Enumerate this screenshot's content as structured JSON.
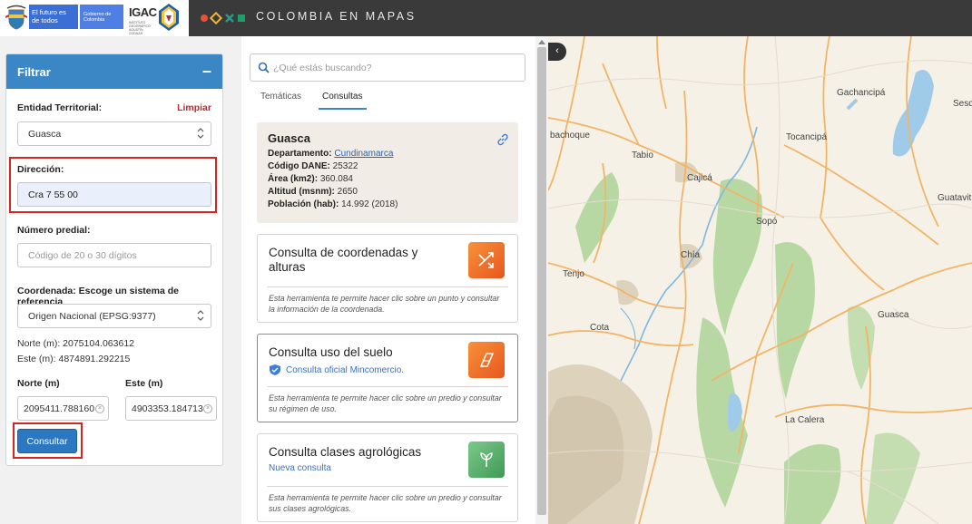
{
  "header": {
    "gov_text_1": "El futuro es de todos",
    "gov_text_2": "Gobierno de Colombia",
    "igac_text": "IGAC",
    "igac_subtitle": "INSTITUTO GEOGRÁFICO AGUSTÍN CODAZZI",
    "title": "COLOMBIA EN MAPAS",
    "brand_colors": [
      "#e8503a",
      "#f2b43a",
      "#2a9b8c",
      "#1e9d6b"
    ]
  },
  "filter": {
    "title": "Filtrar",
    "collapse_label": "–",
    "entity_label": "Entidad Territorial:",
    "clear_label": "Limpiar",
    "entity_value": "Guasca",
    "address_label": "Dirección:",
    "address_value": "Cra 7 55 00",
    "predial_label": "Número predial:",
    "predial_placeholder": "Código de 20 o 30 dígitos",
    "coord_label": "Coordenada: Escoge un sistema de referencia",
    "coord_system": "Origen Nacional (EPSG:9377)",
    "norte_text": "Norte (m): 2075104.063612",
    "este_text": "Este (m): 4874891.292215",
    "norte_input_label": "Norte (m)",
    "este_input_label": "Este (m)",
    "norte_input_value": "2095411.788160",
    "este_input_value": "4903353.184713",
    "submit_label": "Consultar"
  },
  "search": {
    "placeholder": "¿Qué estás buscando?"
  },
  "tabs": [
    {
      "label": "Temáticas",
      "active": false
    },
    {
      "label": "Consultas",
      "active": true
    }
  ],
  "municipality": {
    "name": "Guasca",
    "department_label": "Departamento:",
    "department_value": "Cundinamarca",
    "dane_label": "Código DANE:",
    "dane_value": "25322",
    "area_label": "Área (km2):",
    "area_value": "360.084",
    "altitude_label": "Altitud (msnm):",
    "altitude_value": "2650",
    "population_label": "Población (hab):",
    "population_value": "14.992 (2018)"
  },
  "tools": [
    {
      "title": "Consulta de coordenadas y alturas",
      "subtitle": "",
      "description": "Esta herramienta te permite hacer clic sobre un punto y consultar la información de la coordenada.",
      "icon": "shuffle-icon"
    },
    {
      "title": "Consulta uso del suelo",
      "subtitle": "Consulta oficial Mincomercio.",
      "description": "Esta herramienta te permite hacer clic sobre un predio y consultar su régimen de uso.",
      "icon": "parcel-icon"
    },
    {
      "title": "Consulta clases agrológicas",
      "subtitle": "Nueva consulta",
      "description": "Esta herramienta te permite hacer clic sobre un predio y consultar sus clases agrológicas.",
      "icon": "plant-icon"
    }
  ],
  "map": {
    "collapse_label": "‹",
    "towns": [
      "Gachancipá",
      "Sesq",
      "bachoque",
      "Tabio",
      "Tocancipá",
      "Cajicá",
      "Guatavit",
      "Sopó",
      "Chía",
      "Tenjo",
      "Guasca",
      "Cota",
      "La Calera"
    ]
  }
}
